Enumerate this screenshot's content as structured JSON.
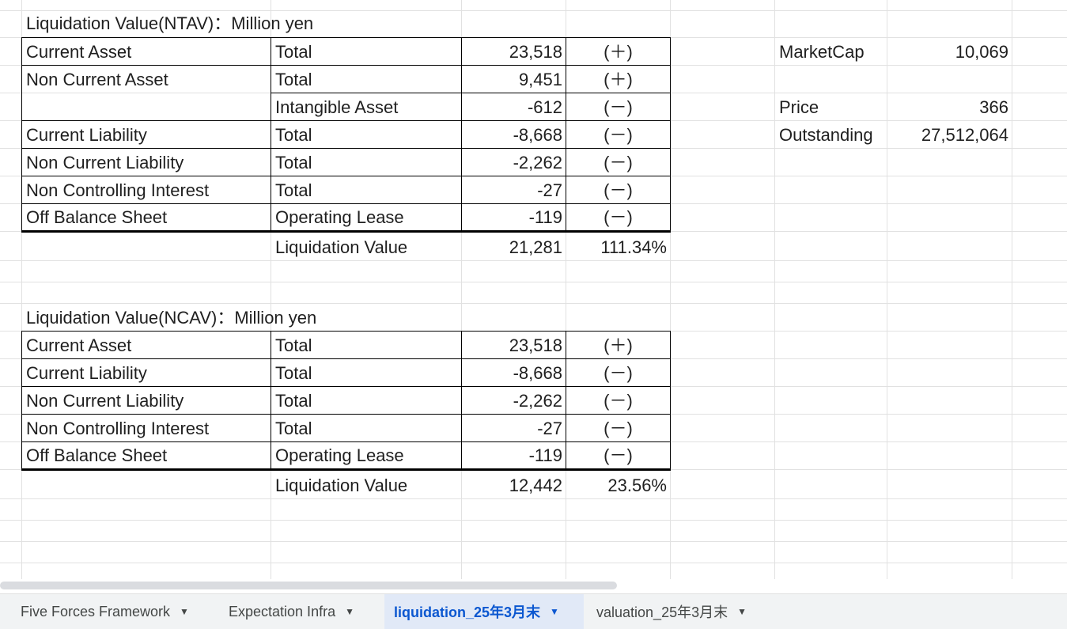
{
  "ntav": {
    "title": "Liquidation Value(NTAV)：Million yen",
    "rows": [
      {
        "label": "Current Asset",
        "sub": "Total",
        "value": "23,518",
        "sign": "(＋)"
      },
      {
        "label": "Non Current Asset",
        "sub": "Total",
        "value": "9,451",
        "sign": "(＋)"
      },
      {
        "label": "",
        "sub": "Intangible Asset",
        "value": "-612",
        "sign": "(－)"
      },
      {
        "label": "Current Liability",
        "sub": "Total",
        "value": "-8,668",
        "sign": "(－)"
      },
      {
        "label": "Non Current Liability",
        "sub": "Total",
        "value": "-2,262",
        "sign": "(－)"
      },
      {
        "label": "Non Controlling Interest",
        "sub": "Total",
        "value": "-27",
        "sign": "(－)"
      },
      {
        "label": "Off Balance Sheet",
        "sub": "Operating Lease",
        "value": "-119",
        "sign": "(－)"
      }
    ],
    "result_label": "Liquidation Value",
    "result_value": "21,281",
    "result_pct": "111.34%"
  },
  "ncav": {
    "title": "Liquidation Value(NCAV)：Million yen",
    "rows": [
      {
        "label": "Current Asset",
        "sub": "Total",
        "value": "23,518",
        "sign": "(＋)"
      },
      {
        "label": "Current Liability",
        "sub": "Total",
        "value": "-8,668",
        "sign": "(－)"
      },
      {
        "label": "Non Current Liability",
        "sub": "Total",
        "value": "-2,262",
        "sign": "(－)"
      },
      {
        "label": "Non Controlling Interest",
        "sub": "Total",
        "value": "-27",
        "sign": "(－)"
      },
      {
        "label": "Off Balance Sheet",
        "sub": "Operating Lease",
        "value": "-119",
        "sign": "(－)"
      }
    ],
    "result_label": "Liquidation Value",
    "result_value": "12,442",
    "result_pct": "23.56%"
  },
  "market": {
    "marketcap_label": "MarketCap",
    "marketcap_value": "10,069",
    "price_label": "Price",
    "price_value": "366",
    "outstanding_label": "Outstanding",
    "outstanding_value": "27,512,064"
  },
  "tabs": [
    {
      "label": "Five Forces Framework",
      "active": false
    },
    {
      "label": "Expectation Infra",
      "active": false
    },
    {
      "label": "liquidation_25年3月末",
      "active": true
    },
    {
      "label": "valuation_25年3月末",
      "active": false
    }
  ],
  "colors": {
    "active_tab_bg": "#e1e9f7",
    "active_tab_text": "#0b57d0",
    "grid": "#e1e1e1"
  }
}
